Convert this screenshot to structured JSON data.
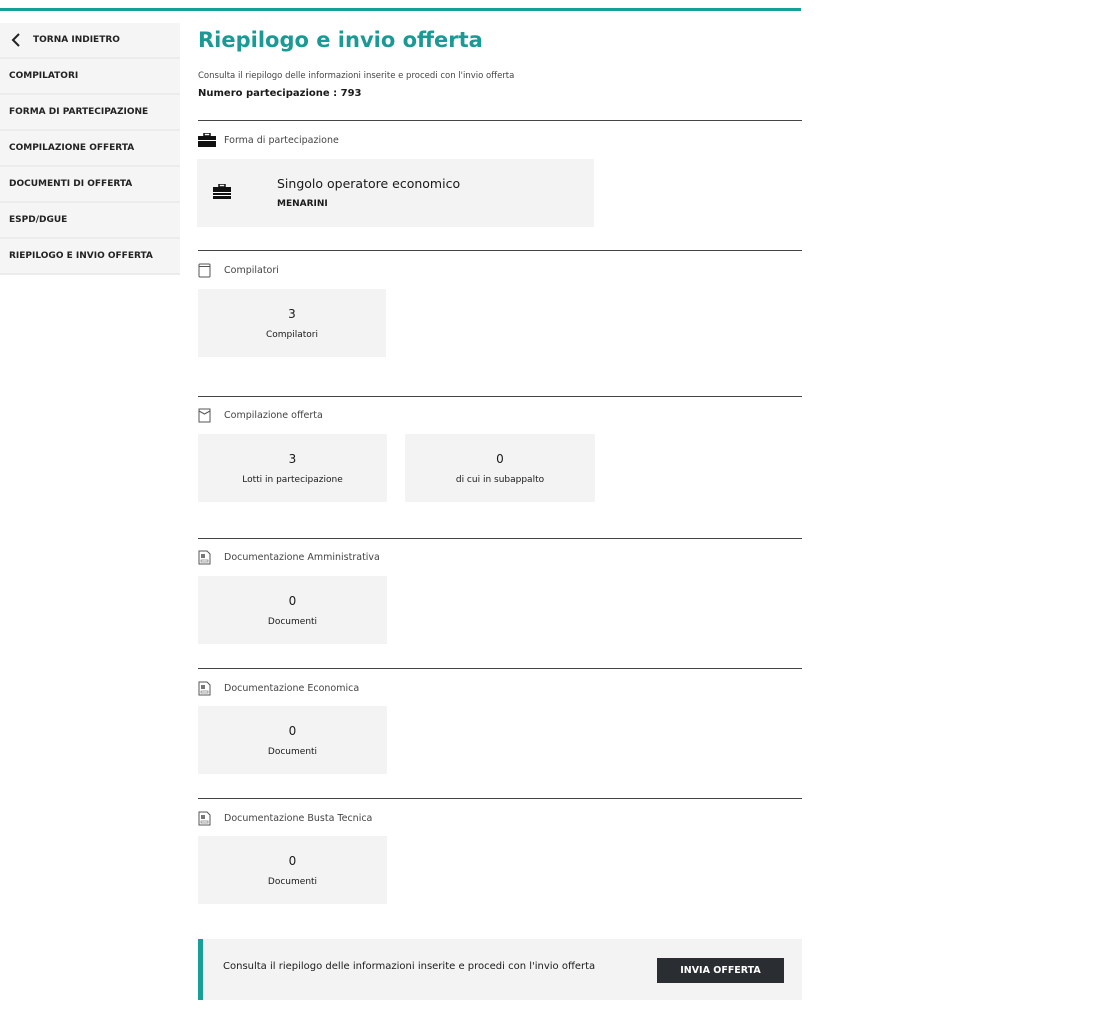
{
  "sidebar": {
    "back": "TORNA INDIETRO",
    "items": [
      "COMPILATORI",
      "FORMA DI PARTECIPAZIONE",
      "COMPILAZIONE OFFERTA",
      "DOCUMENTI DI OFFERTA",
      "ESPD/DGUE",
      "RIEPILOGO E INVIO OFFERTA"
    ]
  },
  "header": {
    "title": "Riepilogo e invio offerta",
    "subtitle": "Consulta il riepilogo delle informazioni inserite e procedi con l'invio offerta",
    "numero": "Numero partecipazione : 793"
  },
  "forma": {
    "label": "Forma di partecipazione",
    "type": "Singolo operatore economico",
    "name": "MENARINI"
  },
  "compilatori": {
    "label": "Compilatori",
    "value": "3",
    "caption": "Compilatori"
  },
  "compilazione": {
    "label": "Compilazione offerta",
    "lotti": {
      "value": "3",
      "caption": "Lotti in partecipazione"
    },
    "sub": {
      "value": "0",
      "caption": "di cui in subappalto"
    }
  },
  "doc_amm": {
    "label": "Documentazione Amministrativa",
    "value": "0",
    "caption": "Documenti"
  },
  "doc_eco": {
    "label": "Documentazione Economica",
    "value": "0",
    "caption": "Documenti"
  },
  "doc_tec": {
    "label": "Documentazione Busta Tecnica",
    "value": "0",
    "caption": "Documenti"
  },
  "banner": {
    "text": "Consulta il riepilogo delle informazioni inserite e procedi con l'invio offerta",
    "button": "INVIA OFFERTA"
  }
}
